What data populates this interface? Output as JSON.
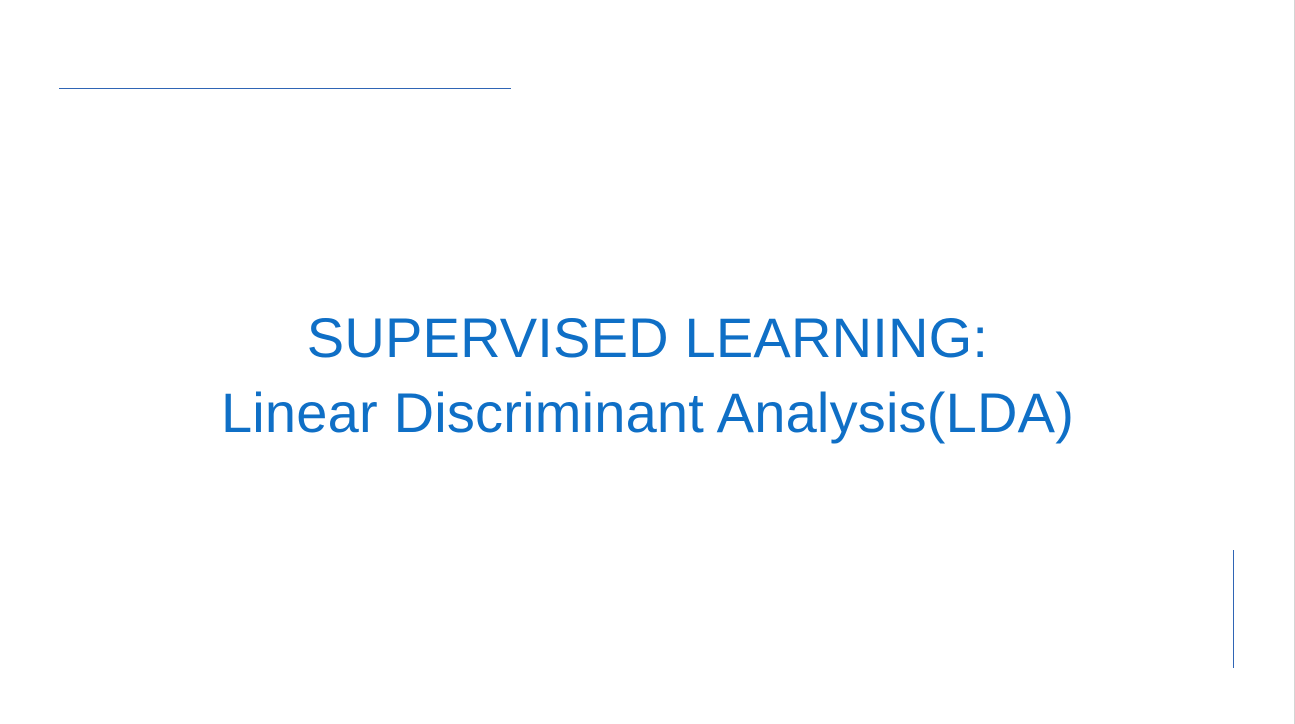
{
  "slide": {
    "title_line_1": "SUPERVISED LEARNING:",
    "title_line_2": "Linear Discriminant Analysis(LDA)"
  },
  "colors": {
    "title_text": "#0f6fc6",
    "accent_rule": "#2f65b5",
    "background": "#ffffff"
  }
}
